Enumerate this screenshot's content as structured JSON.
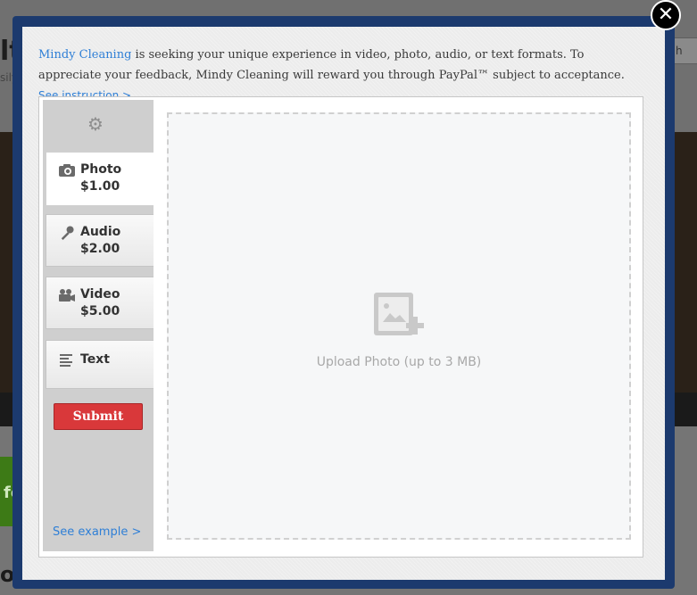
{
  "background": {
    "heading_fragment": "lt",
    "sub_fragment": "sily",
    "search_fragment": "h",
    "green_button_fragment": "fe",
    "bottom_fragment": "o"
  },
  "modal": {
    "close_label": "✕",
    "intro": {
      "company_link": "Mindy Cleaning",
      "text": " is seeking your unique experience in video, photo, audio, or text formats. To appreciate your feedback, Mindy Cleaning will reward you through PayPal™ subject to acceptance. ",
      "instruction_link": "See instruction >"
    },
    "media_tabs": [
      {
        "name": "Photo",
        "price": "$1.00",
        "icon": "camera-icon",
        "active": true
      },
      {
        "name": "Audio",
        "price": "$2.00",
        "icon": "microphone-icon",
        "active": false
      },
      {
        "name": "Video",
        "price": "$5.00",
        "icon": "video-camera-icon",
        "active": false
      },
      {
        "name": "Text",
        "price": "",
        "icon": "text-lines-icon",
        "active": false
      }
    ],
    "submit_label": "Submit",
    "see_example_label": "See example >",
    "upload_text": "Upload Photo (up to 3 MB)"
  },
  "colors": {
    "frame": "#1c3a6e",
    "link": "#2f7fd6",
    "submit": "#d9383a"
  }
}
